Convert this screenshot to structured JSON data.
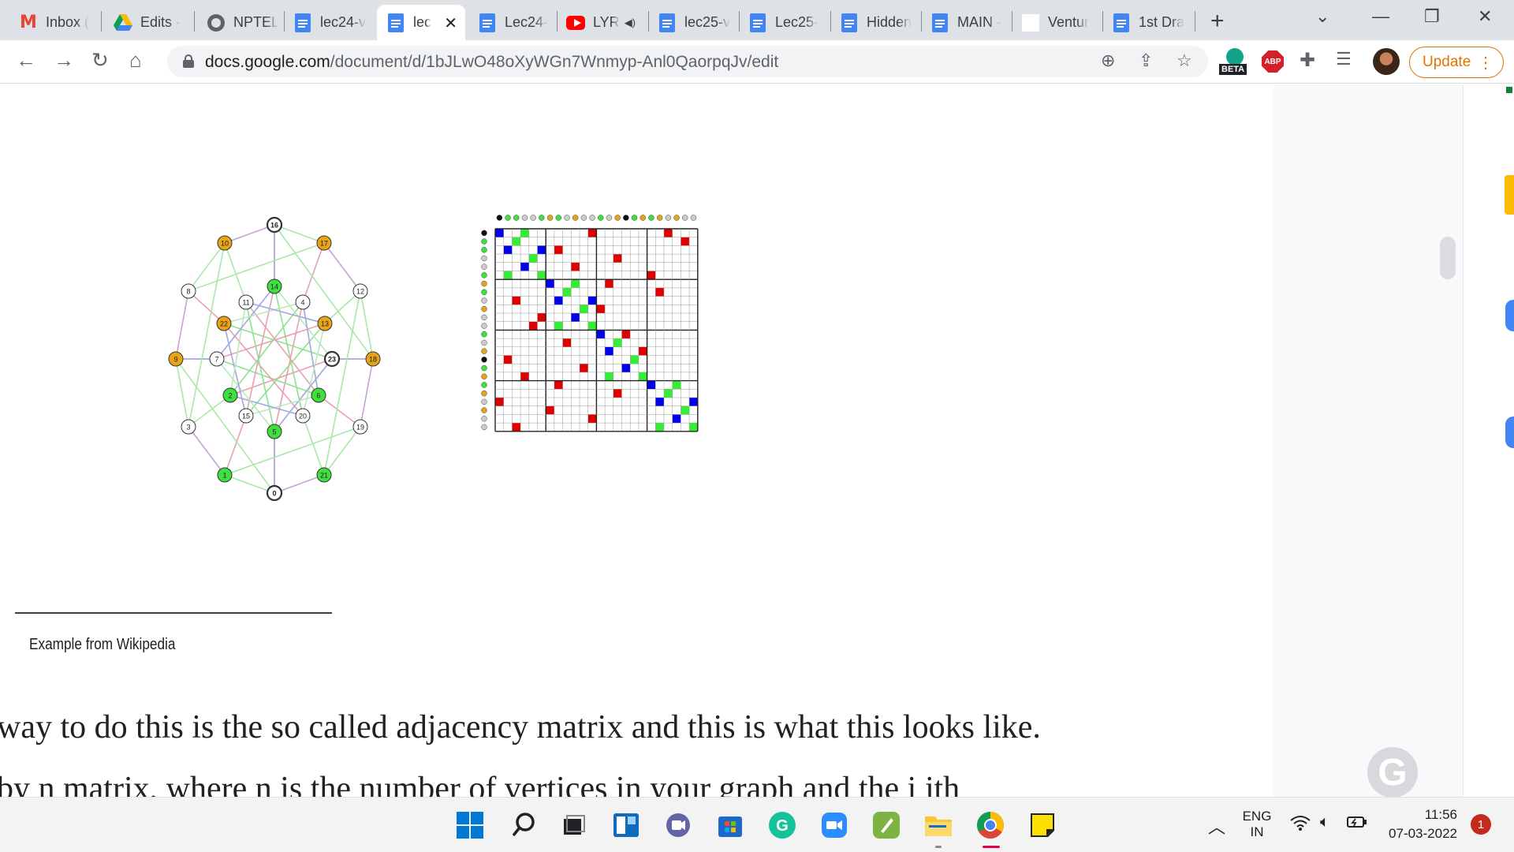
{
  "tabs": [
    {
      "label": "Inbox (",
      "icon": "gmail-icon"
    },
    {
      "label": "Edits -",
      "icon": "google-drive-icon"
    },
    {
      "label": "NPTEL",
      "icon": "globe-icon"
    },
    {
      "label": "lec24-v",
      "icon": "google-docs-icon"
    },
    {
      "label": "lec",
      "icon": "google-docs-icon",
      "active": true
    },
    {
      "label": "Lec24-",
      "icon": "google-docs-icon"
    },
    {
      "label": "LYR",
      "icon": "youtube-icon"
    },
    {
      "label": "lec25-v",
      "icon": "google-docs-icon"
    },
    {
      "label": "Lec25-",
      "icon": "google-docs-icon"
    },
    {
      "label": "Hidden",
      "icon": "google-docs-icon"
    },
    {
      "label": "MAIN -",
      "icon": "google-docs-icon"
    },
    {
      "label": "Ventur",
      "icon": "blank-page-icon"
    },
    {
      "label": "1st Dra",
      "icon": "google-docs-icon"
    }
  ],
  "address_bar": {
    "domain": "docs.google.com",
    "path": "/document/d/1bJLwO48oXyWGn7Wnmyp-Anl0QaorpqJv/edit"
  },
  "toolbar": {
    "update_label": "Update",
    "beta_label": "BETA",
    "abp_label": "ABP"
  },
  "document": {
    "footnote": "Example from Wikipedia",
    "body_lines": [
      "way to do this is the so called adjacency matrix and this is what this looks like.",
      " by n matrix, where n is the number of vertices in your graph and the i jth"
    ]
  },
  "figure_graph": {
    "vertex_labels": [
      "16",
      "17",
      "12",
      "18",
      "19",
      "21",
      "0",
      "1",
      "3",
      "9",
      "8",
      "10",
      "14",
      "4",
      "13",
      "23",
      "6",
      "20",
      "5",
      "15",
      "2",
      "7",
      "22",
      "11"
    ],
    "colors": {
      "orange": "#e8a317",
      "green": "#3ee03e",
      "white": "#ffffff",
      "black": "#111111"
    }
  },
  "figure_matrix": {
    "colors": {
      "blue": "#0000ee",
      "green": "#33ee33",
      "red": "#e00000"
    }
  },
  "taskbar": {
    "language": "ENG",
    "region": "IN",
    "time": "11:56",
    "date": "07-03-2022",
    "notification_count": "1"
  }
}
